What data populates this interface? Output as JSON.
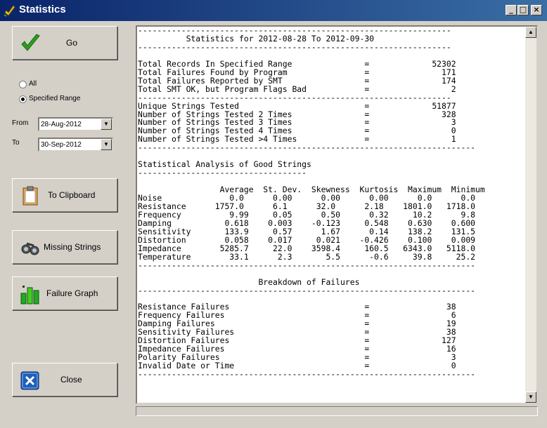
{
  "window": {
    "title": "Statistics",
    "minimize": "_",
    "maximize": "□",
    "close": "×"
  },
  "buttons": {
    "go": "Go",
    "clipboard": "To Clipboard",
    "missing": "Missing Strings",
    "graph": "Failure Graph",
    "close": "Close"
  },
  "range": {
    "all_label": "All",
    "specified_label": "Specified Range",
    "selected": "Specified Range",
    "from_label": "From",
    "to_label": "To",
    "from_value": "28-Aug-2012",
    "to_value": "30-Sep-2012"
  },
  "report": {
    "lines": [
      "-----------------------------------------------------------------",
      "          Statistics for 2012-08-28 To 2012-09-30",
      "-----------------------------------------------------------------",
      "",
      "Total Records In Specified Range               =             52302",
      "Total Failures Found by Program                =               171",
      "Total Failures Reported by SMT                 =               174",
      "Total SMT OK, but Program Flags Bad            =                 2",
      "-----------------------------------------------------------------",
      "Unique Strings Tested                          =             51877",
      "Number of Strings Tested 2 Times               =               328",
      "Number of Strings Tested 3 Times               =                 3",
      "Number of Strings Tested 4 Times               =                 0",
      "Number of Strings Tested >4 Times              =                 1",
      "----------------------------------------------------------------------",
      "",
      "Statistical Analysis of Good Strings",
      "-----------------------------------",
      "",
      "                 Average  St. Dev.  Skewness  Kurtosis  Maximum  Minimum",
      "Noise              0.0      0.00      0.00      0.00      0.0      0.0",
      "Resistance      1757.0      6.1      32.0      2.18    1801.0   1718.0",
      "Frequency          9.99     0.05      0.50      0.32     10.2      9.8",
      "Damping           0.618    0.003    -0.123     0.548    0.630    0.600",
      "Sensitivity       133.9     0.57      1.67      0.14    138.2    131.5",
      "Distortion        0.058    0.017     0.021    -0.426    0.100    0.009",
      "Impedance        5285.7     22.0    3598.4     160.5   6343.0   5118.0",
      "Temperature        33.1      2.3       5.5      -0.6     39.8     25.2",
      "----------------------------------------------------------------------",
      "",
      "                         Breakdown of Failures",
      "----------------------------------------------------------------------",
      "",
      "Resistance Failures                            =                38",
      "Frequency Failures                             =                 6",
      "Damping Failures                               =                19",
      "Sensitivity Failures                           =                38",
      "Distortion Failures                            =               127",
      "Impedance Failures                             =                16",
      "Polarity Failures                              =                 3",
      "Invalid Date or Time                           =                 0",
      "----------------------------------------------------------------------"
    ]
  },
  "colors": {
    "titlebar": "#0a246a",
    "go_check": "#2e9e1e",
    "close_x": "#1f5fb8"
  }
}
